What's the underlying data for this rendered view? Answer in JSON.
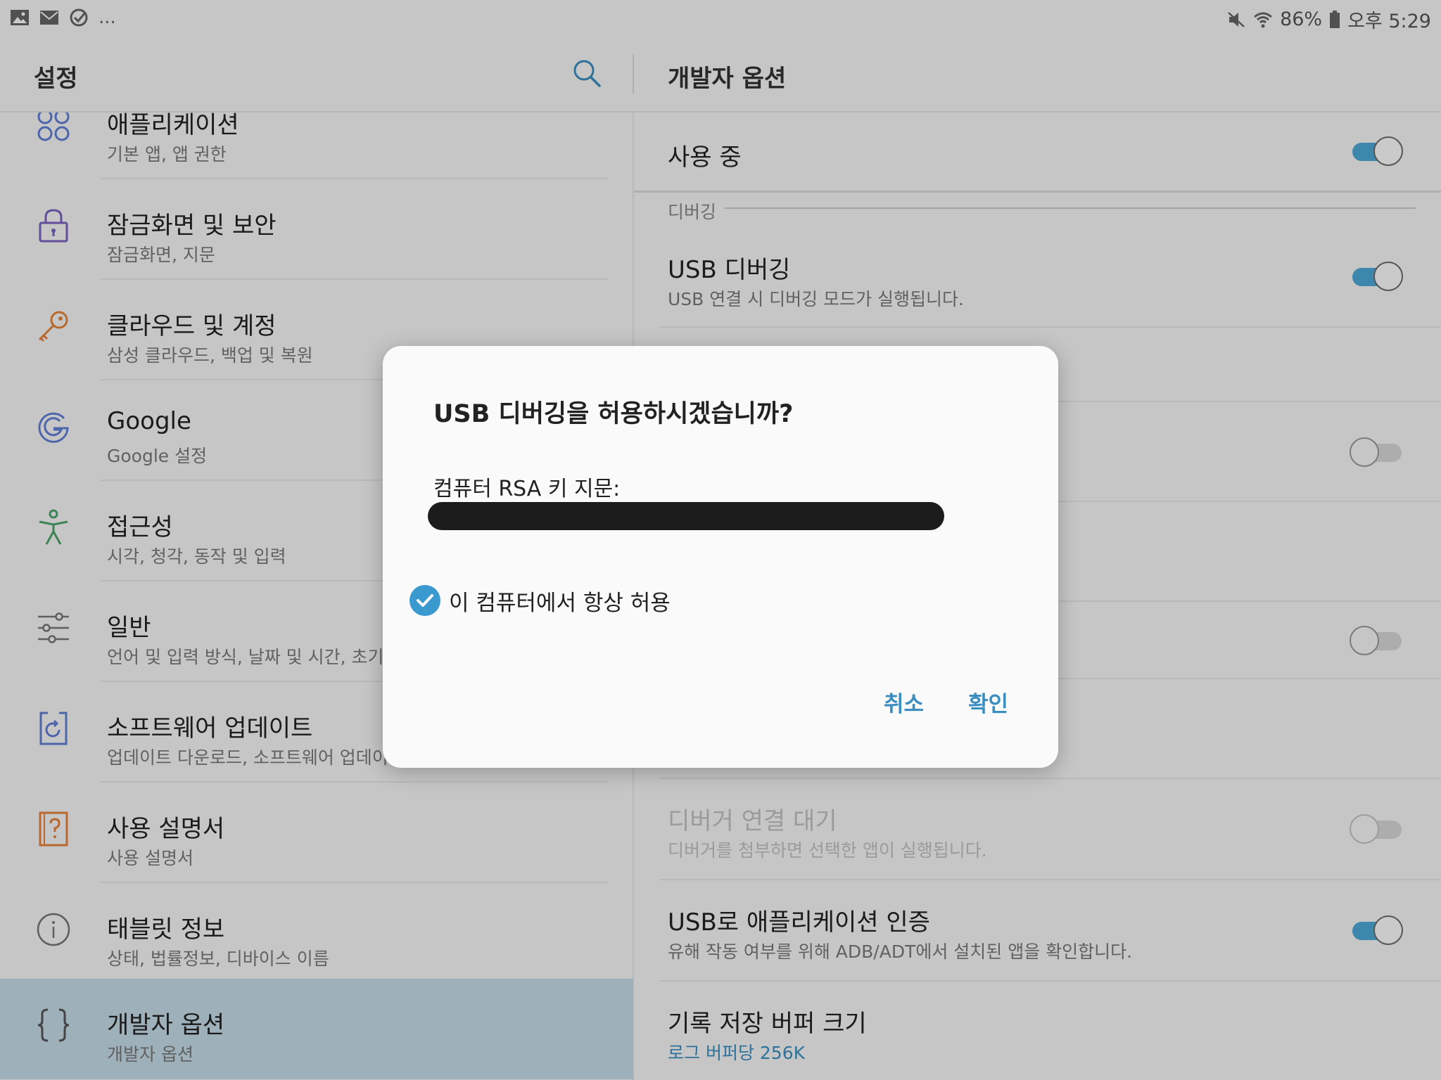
{
  "status_bar": {
    "icons_left": [
      "gallery-icon",
      "email-icon",
      "task-check-icon"
    ],
    "more": "...",
    "icons_right": [
      "mute-icon",
      "wifi-icon",
      "battery-icon"
    ],
    "battery": "86%",
    "time": "오후 5:29"
  },
  "left_pane": {
    "title": "설정",
    "items": [
      {
        "title": "애플리케이션",
        "sub": "기본 앱, 앱 권한",
        "icon": "apps-grid-icon",
        "color": "#5f7fd6"
      },
      {
        "title": "잠금화면 및 보안",
        "sub": "잠금화면, 지문",
        "icon": "lock-icon",
        "color": "#7b63c4"
      },
      {
        "title": "클라우드 및 계정",
        "sub": "삼성 클라우드, 백업 및 복원",
        "icon": "key-icon",
        "color": "#e8833a"
      },
      {
        "title": "Google",
        "sub": "Google 설정",
        "icon": "google-icon",
        "color": "#5f7fd6"
      },
      {
        "title": "접근성",
        "sub": "시각, 청각, 동작 및 입력",
        "icon": "accessibility-icon",
        "color": "#4ca66b"
      },
      {
        "title": "일반",
        "sub": "언어 및 입력 방식, 날짜 및 시간, 초기화",
        "icon": "sliders-icon",
        "color": "#777777"
      },
      {
        "title": "소프트웨어 업데이트",
        "sub": "업데이트 다운로드, 소프트웨어 업데이트",
        "icon": "software-update-icon",
        "color": "#5f7fd6"
      },
      {
        "title": "사용 설명서",
        "sub": "사용 설명서",
        "icon": "user-manual-icon",
        "color": "#e8833a"
      },
      {
        "title": "태블릿 정보",
        "sub": "상태, 법률정보, 디바이스 이름",
        "icon": "info-icon",
        "color": "#777777"
      },
      {
        "title": "개발자 옵션",
        "sub": "개발자 옵션",
        "icon": "braces-icon",
        "color": "#555555"
      }
    ]
  },
  "right_pane": {
    "title": "개발자 옵션",
    "master": {
      "title": "사용 중",
      "on": true
    },
    "section_debugging": "디버깅",
    "usb_debugging": {
      "title": "USB 디버깅",
      "sub": "USB 연결 시 디버깅 모드가 실행됩니다.",
      "on": true
    },
    "wait_debugger": {
      "title": "디버거 연결 대기",
      "sub": "디버거를 첨부하면 선택한 앱이 실행됩니다.",
      "on": false
    },
    "verify_apps": {
      "title": "USB로 애플리케이션 인증",
      "sub": "유해 작동 여부를 위해 ADB/ADT에서 설치된 앱을 확인합니다.",
      "on": true
    },
    "logger_buffer": {
      "title": "기록 저장 버퍼 크기",
      "sub": "로그 버퍼당 256K"
    }
  },
  "dialog": {
    "title": "USB 디버깅을 허용하시겠습니까?",
    "fingerprint_label": "컴퓨터 RSA 키 지문:",
    "always_allow_label": "이 컴퓨터에서 항상 허용",
    "always_allow_checked": true,
    "cancel": "취소",
    "ok": "확인"
  }
}
